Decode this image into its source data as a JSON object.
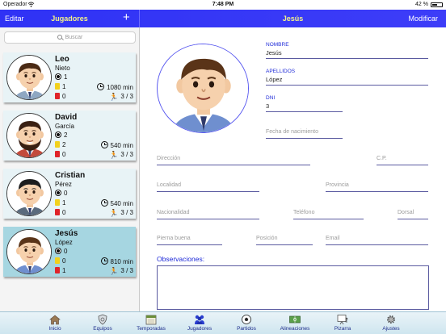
{
  "status": {
    "carrier": "Operador",
    "time": "7:48 PM",
    "battery": "42 %",
    "battery_level": 0.42
  },
  "nav": {
    "edit": "Editar",
    "left_title": "Jugadores",
    "add": "+",
    "right_title": "Jesús",
    "modify": "Modificar"
  },
  "search": {
    "placeholder": "Buscar"
  },
  "players": [
    {
      "name": "Leo",
      "surname": "Nieto",
      "goals": "1",
      "yellow": "1",
      "red": "0",
      "minutes": "1080 min",
      "matches": "3 / 3",
      "beard": false,
      "hair": "#4a2a14",
      "shirt": "#8fa7c2",
      "selected": false
    },
    {
      "name": "David",
      "surname": "García",
      "goals": "2",
      "yellow": "2",
      "red": "0",
      "minutes": "540 min",
      "matches": "3 / 3",
      "beard": true,
      "hair": "#3a2012",
      "shirt": "#c24a3c",
      "selected": false
    },
    {
      "name": "Cristian",
      "surname": "Pérez",
      "goals": "0",
      "yellow": "1",
      "red": "0",
      "minutes": "540 min",
      "matches": "3 / 3",
      "beard": false,
      "hair": "#1c1c1c",
      "shirt": "#5a6b7d",
      "selected": false
    },
    {
      "name": "Jesús",
      "surname": "López",
      "goals": "0",
      "yellow": "0",
      "red": "1",
      "minutes": "810 min",
      "matches": "3 / 3",
      "beard": false,
      "hair": "#5a3418",
      "shirt": "#6f8fcf",
      "selected": true
    }
  ],
  "form": {
    "nombre_label": "NOMBRE",
    "nombre": "Jesús",
    "apellidos_label": "APELLIDOS",
    "apellidos": "López",
    "dni_label": "DNI",
    "dni": "3",
    "fecha_placeholder": "Fecha de nacimiento",
    "direccion": "Dirección",
    "cp": "C.P.",
    "localidad": "Localidad",
    "provincia": "Provincia",
    "nacionalidad": "Nacionalidad",
    "telefono": "Teléfono",
    "dorsal": "Dorsal",
    "pierna": "Pierna buena",
    "posicion": "Posición",
    "email": "Email",
    "observaciones": "Observaciones:"
  },
  "tabs": [
    {
      "label": "Inicio",
      "icon": "home-icon",
      "active": false
    },
    {
      "label": "Equipos",
      "icon": "shield-icon",
      "active": false
    },
    {
      "label": "Temporadas",
      "icon": "calendar-icon",
      "active": false
    },
    {
      "label": "Jugadores",
      "icon": "players-icon",
      "active": true
    },
    {
      "label": "Partidos",
      "icon": "ball-icon",
      "active": false
    },
    {
      "label": "Alineaciones",
      "icon": "field-icon",
      "active": false
    },
    {
      "label": "Pizarra",
      "icon": "board-icon",
      "active": false
    },
    {
      "label": "Ajustes",
      "icon": "gear-icon",
      "active": false
    }
  ],
  "colors": {
    "nav": "#3434f6",
    "accent_yellow": "#f3f38a",
    "label_blue": "#1e2ad8",
    "selected_row": "#a6d6e1",
    "row": "#e8f3f6"
  }
}
